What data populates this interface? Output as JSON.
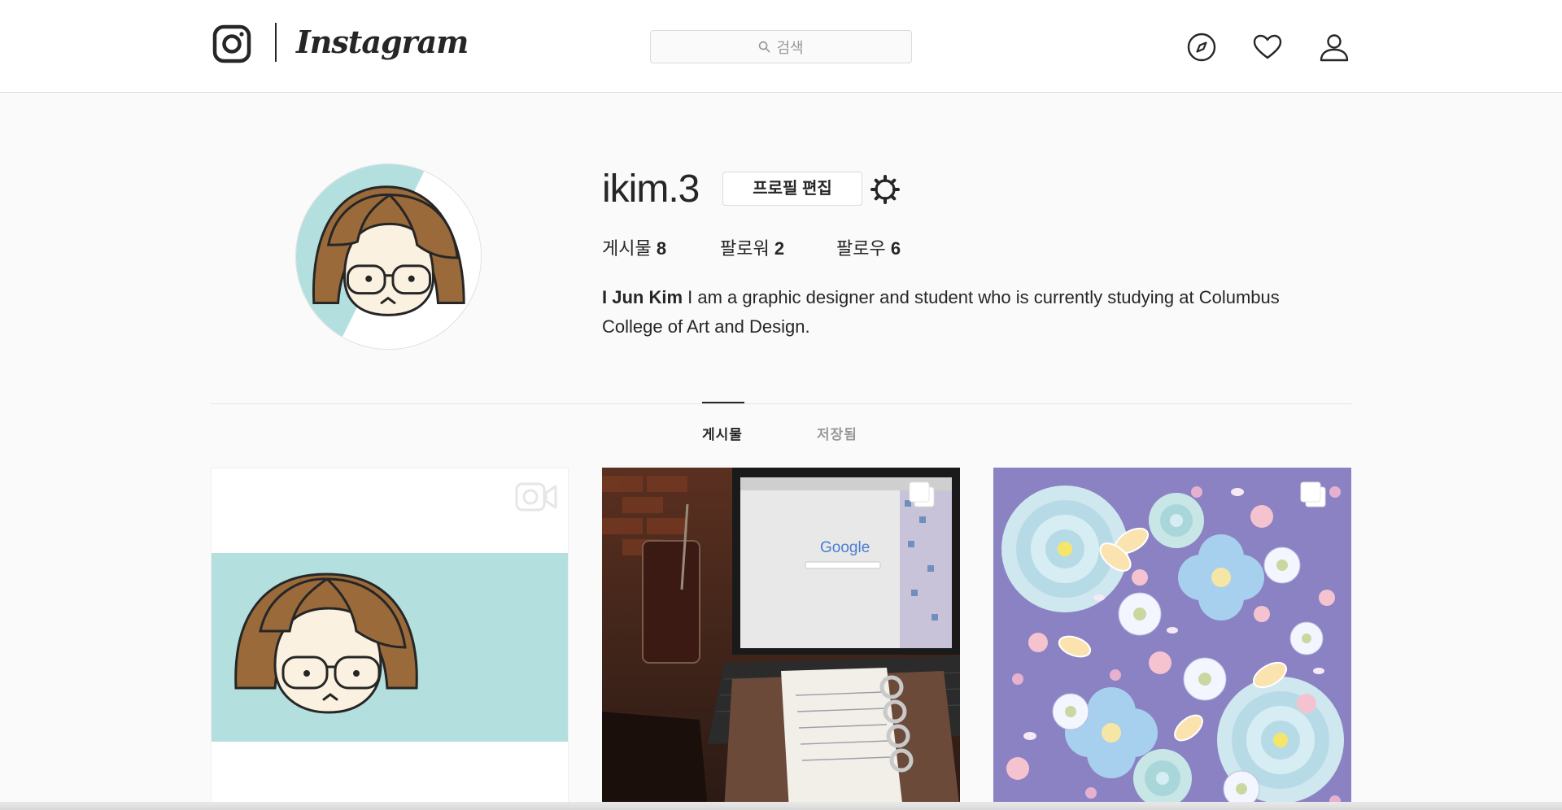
{
  "nav": {
    "wordmark": "Instagram",
    "search_placeholder": "검색",
    "icons": [
      "instagram-camera-icon",
      "compass-icon",
      "heart-icon",
      "user-icon"
    ]
  },
  "profile": {
    "username": "ikim.3",
    "edit_label": "프로필 편집",
    "stats": [
      {
        "label": "게시물",
        "count": "8"
      },
      {
        "label": "팔로워",
        "count": "2"
      },
      {
        "label": "팔로우",
        "count": "6"
      }
    ],
    "full_name": "I Jun Kim",
    "bio": "I am a graphic designer and student who is currently studying at Columbus College of Art and Design."
  },
  "tabs": [
    {
      "label": "게시물",
      "active": true
    },
    {
      "label": "저장됨",
      "active": false
    }
  ],
  "posts": [
    {
      "type": "video",
      "badge_icon": "video-camera-icon",
      "description_icon": "cartoon-portrait"
    },
    {
      "type": "carousel",
      "badge_icon": "multiple-images-icon",
      "screen_text": "Google"
    },
    {
      "type": "carousel",
      "badge_icon": "multiple-images-icon"
    }
  ],
  "colors": {
    "accent_teal": "#b3dfdf",
    "hair_brown": "#9a6a3b",
    "skin": "#fbf1e0",
    "flower_bg": "#8b82c3",
    "border": "#dbdbdb",
    "text": "#262626",
    "muted": "#999999"
  }
}
